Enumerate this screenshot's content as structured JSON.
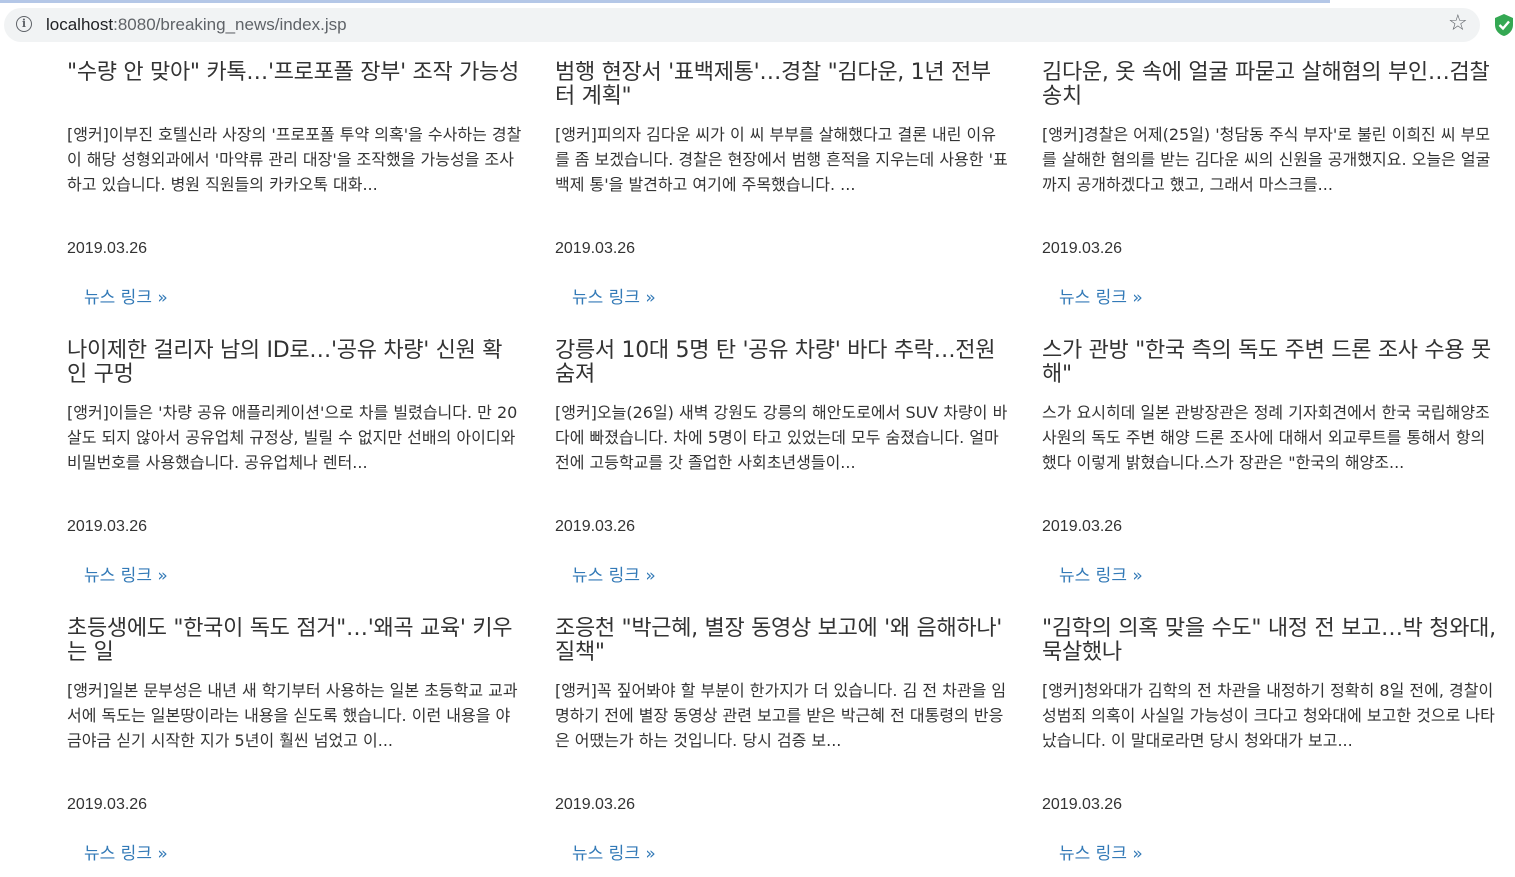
{
  "browser": {
    "url_host": "localhost",
    "url_rest": ":8080/breaking_news/index.jsp"
  },
  "link_label": "뉴스 링크 »",
  "articles": [
    {
      "title": "\"수량 안 맞아\" 카톡…'프로포폴 장부' 조작 가능성",
      "body": "[앵커]이부진 호텔신라 사장의 '프로포폴 투약 의혹'을 수사하는 경찰이 해당 성형외과에서 '마약류 관리 대장'을 조작했을 가능성을 조사하고 있습니다. 병원 직원들의 카카오톡 대화...",
      "date": "2019.03.26"
    },
    {
      "title": "범행 현장서 '표백제통'…경찰 \"김다운, 1년 전부터 계획\"",
      "body": "[앵커]피의자 김다운 씨가 이 씨 부부를 살해했다고 결론 내린 이유를 좀 보겠습니다. 경찰은 현장에서 범행 흔적을 지우는데 사용한 '표백제 통'을 발견하고 여기에 주목했습니다. ...",
      "date": "2019.03.26"
    },
    {
      "title": "김다운, 옷 속에 얼굴 파묻고 살해혐의 부인…검찰 송치",
      "body": "[앵커]경찰은 어제(25일) '청담동 주식 부자'로 불린 이희진 씨 부모를 살해한 혐의를 받는 김다운 씨의 신원을 공개했지요. 오늘은 얼굴까지 공개하겠다고 했고, 그래서 마스크를...",
      "date": "2019.03.26"
    },
    {
      "title": "나이제한 걸리자 남의 ID로…'공유 차량' 신원 확인 구멍",
      "body": "[앵커]이들은 '차량 공유 애플리케이션'으로 차를 빌렸습니다. 만 20살도 되지 않아서 공유업체 규정상, 빌릴 수 없지만 선배의 아이디와 비밀번호를 사용했습니다. 공유업체나 렌터...",
      "date": "2019.03.26"
    },
    {
      "title": "강릉서 10대 5명 탄 '공유 차량' 바다 추락…전원 숨져",
      "body": "[앵커]오늘(26일) 새벽 강원도 강릉의 해안도로에서 SUV 차량이 바다에 빠졌습니다. 차에 5명이 타고 있었는데 모두 숨졌습니다. 얼마 전에 고등학교를 갓 졸업한 사회초년생들이...",
      "date": "2019.03.26"
    },
    {
      "title": "스가 관방 \"한국 측의 독도 주변 드론 조사 수용 못 해\"",
      "body": "스가 요시히데 일본 관방장관은 정례 기자회견에서 한국 국립해양조사원의 독도 주변 해양 드론 조사에 대해서 외교루트를 통해서 항의했다 이렇게 밝혔습니다.스가 장관은 \"한국의 해양조...",
      "date": "2019.03.26"
    },
    {
      "title": "초등생에도 \"한국이 독도 점거\"…'왜곡 교육' 키우는 일",
      "body": "[앵커]일본 문부성은 내년 새 학기부터 사용하는 일본 초등학교 교과서에 독도는 일본땅이라는 내용을 싣도록 했습니다. 이런 내용을 야금야금 싣기 시작한 지가 5년이 훨씬 넘었고 이...",
      "date": "2019.03.26"
    },
    {
      "title": "조응천 \"박근혜, 별장 동영상 보고에 '왜 음해하나' 질책\"",
      "body": "[앵커]꼭 짚어봐야 할 부분이 한가지가 더 있습니다. 김 전 차관을 임명하기 전에 별장 동영상 관련 보고를 받은 박근혜 전 대통령의 반응은 어땠는가 하는 것입니다. 당시 검증 보...",
      "date": "2019.03.26"
    },
    {
      "title": "\"김학의 의혹 맞을 수도\" 내정 전 보고…박 청와대, 묵살했나",
      "body": "[앵커]청와대가 김학의 전 차관을 내정하기 정확히 8일 전에, 경찰이 성범죄 의혹이 사실일 가능성이 크다고 청와대에 보고한 것으로 나타났습니다. 이 말대로라면 당시 청와대가 보고...",
      "date": "2019.03.26"
    }
  ]
}
